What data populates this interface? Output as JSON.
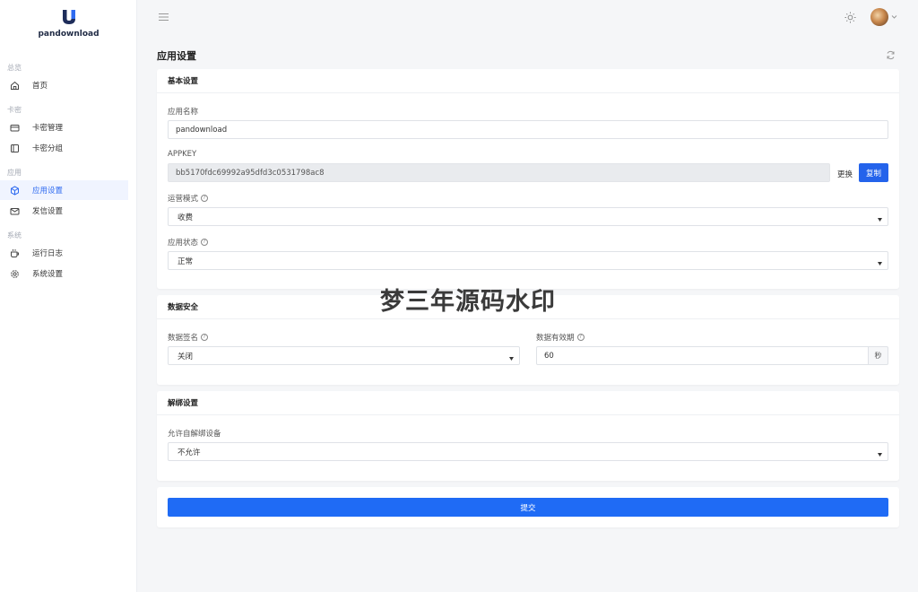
{
  "brand": {
    "name": "pandownload",
    "logo_letter": "U"
  },
  "sidebar": {
    "sections": [
      {
        "title": "总览",
        "items": [
          {
            "label": "首页",
            "icon": "home-icon"
          }
        ]
      },
      {
        "title": "卡密",
        "items": [
          {
            "label": "卡密管理",
            "icon": "card-icon"
          },
          {
            "label": "卡密分组",
            "icon": "panel-icon"
          }
        ]
      },
      {
        "title": "应用",
        "items": [
          {
            "label": "应用设置",
            "icon": "cube-icon",
            "active": true
          },
          {
            "label": "发信设置",
            "icon": "mail-icon"
          }
        ]
      },
      {
        "title": "系统",
        "items": [
          {
            "label": "运行日志",
            "icon": "cup-icon"
          },
          {
            "label": "系统设置",
            "icon": "gear-icon"
          }
        ]
      }
    ]
  },
  "page": {
    "title": "应用设置"
  },
  "basic": {
    "header": "基本设置",
    "app_name_label": "应用名称",
    "app_name_value": "pandownload",
    "appkey_label": "APPKEY",
    "appkey_value": "bb5170fdc69992a95dfd3c0531798ac8",
    "replace_label": "更换",
    "copy_label": "复制",
    "mode_label": "运营模式",
    "mode_value": "收费",
    "status_label": "应用状态",
    "status_value": "正常"
  },
  "security": {
    "header": "数据安全",
    "sign_label": "数据签名",
    "sign_value": "关闭",
    "validity_label": "数据有效期",
    "validity_value": "60",
    "validity_unit": "秒"
  },
  "unbind": {
    "header": "解绑设置",
    "allow_label": "允许自解绑设备",
    "allow_value": "不允许"
  },
  "submit_label": "提交",
  "watermark": "梦三年源码水印",
  "colors": {
    "primary": "#1f6bf5",
    "active_bg": "#f0f4ff",
    "active_text": "#2f6bf0"
  }
}
